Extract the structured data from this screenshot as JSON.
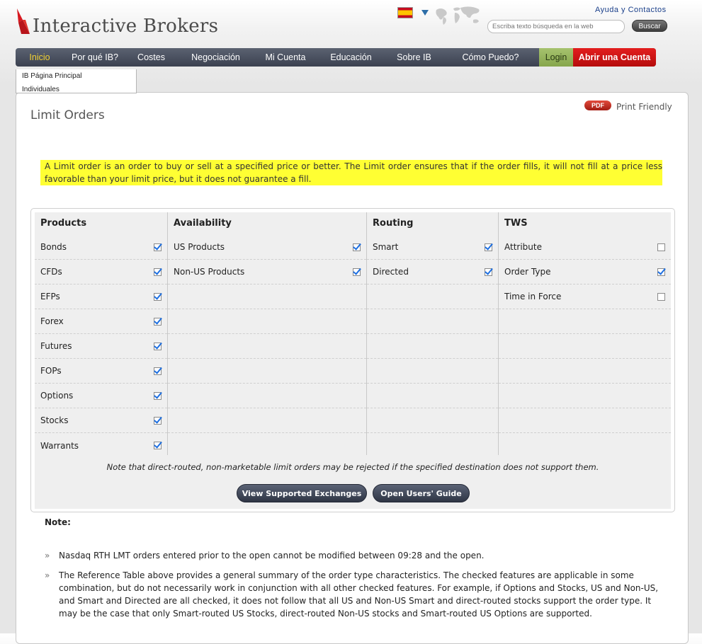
{
  "header": {
    "logo_text": "Interactive Brokers",
    "help_link": "Ayuda y Contactos",
    "search": {
      "placeholder": "Escriba texto búsqueda en la web",
      "button": "Buscar"
    },
    "colors": {
      "accent_red": "#d71920",
      "nav_bg": "#4a5160",
      "active_nav": "#f3d233"
    }
  },
  "nav": {
    "items": [
      "Inicio",
      "Por qué IB?",
      "Costes",
      "Negociación",
      "Mi Cuenta",
      "Educación",
      "Sobre IB",
      "Cómo Puedo?"
    ],
    "login": "Login",
    "open_account": "Abrir una Cuenta"
  },
  "subnav": {
    "items": [
      "IB Página Principal",
      "Individuales"
    ]
  },
  "page": {
    "title": "Limit Orders",
    "pdf_badge": "PDF",
    "print_friendly": "Print Friendly",
    "description": "A Limit order is an order to buy or sell at a specified price or better. The Limit order ensures that if the order fills, it will not fill at a price less favorable than your limit price, but it does not guarantee a fill."
  },
  "table": {
    "columns": [
      {
        "header": "Products",
        "rows": [
          {
            "label": "Bonds",
            "checked": true
          },
          {
            "label": "CFDs",
            "checked": true
          },
          {
            "label": "EFPs",
            "checked": true
          },
          {
            "label": "Forex",
            "checked": true
          },
          {
            "label": "Futures",
            "checked": true
          },
          {
            "label": "FOPs",
            "checked": true
          },
          {
            "label": "Options",
            "checked": true
          },
          {
            "label": "Stocks",
            "checked": true
          },
          {
            "label": "Warrants",
            "checked": true
          }
        ]
      },
      {
        "header": "Availability",
        "rows": [
          {
            "label": "US Products",
            "checked": true
          },
          {
            "label": "Non-US Products",
            "checked": true
          }
        ]
      },
      {
        "header": "Routing",
        "rows": [
          {
            "label": "Smart",
            "checked": true
          },
          {
            "label": "Directed",
            "checked": true
          }
        ]
      },
      {
        "header": "TWS",
        "rows": [
          {
            "label": "Attribute",
            "checked": false
          },
          {
            "label": "Order Type",
            "checked": true
          },
          {
            "label": "Time in Force",
            "checked": false
          }
        ]
      }
    ],
    "footnote": "Note that direct-routed, non-marketable limit orders may be rejected if the specified destination does not support them.",
    "buttons": {
      "exchanges": "View Supported Exchanges",
      "guide": "Open Users' Guide"
    }
  },
  "notes": {
    "label": "Note:",
    "items": [
      "Nasdaq RTH LMT orders entered prior to the open cannot be modified between 09:28 and the open.",
      "The Reference Table above provides a general summary of the order type characteristics. The checked features are applicable in some combination, but do not necessarily work in conjunction with all other checked features. For example, if Options and Stocks, US and Non-US, and Smart and Directed are all checked, it does not follow that all US and Non-US Smart and direct-routed stocks support the order type. It may be the case that only Smart-routed US Stocks, direct-routed Non-US stocks and Smart-routed US Options are supported."
    ]
  }
}
